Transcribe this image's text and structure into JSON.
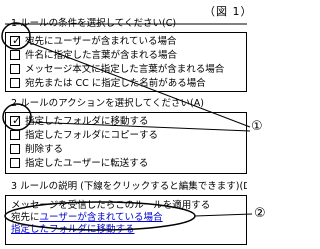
{
  "figure_label": "（図 1）",
  "section1": {
    "header": "1 ルールの条件を選択してください(C)",
    "items": [
      {
        "label": "宛先にユーザーが含まれている場合",
        "checked": true
      },
      {
        "label": "件名に指定した言葉が含まれる場合",
        "checked": false
      },
      {
        "label": "メッセージ本文に指定した言葉が含まれる場合",
        "checked": false
      },
      {
        "label": "宛先または CC に指定した名前がある場合",
        "checked": false
      }
    ]
  },
  "section2": {
    "header": "2 ルールのアクションを選択してください(A)",
    "items": [
      {
        "label": "指定したフォルダに移動する",
        "checked": true
      },
      {
        "label": "指定したフォルダにコピーする",
        "checked": false
      },
      {
        "label": "削除する",
        "checked": false
      },
      {
        "label": "指定したユーザーに転送する",
        "checked": false
      }
    ]
  },
  "section3": {
    "header": "3 ルールの説明 (下線をクリックすると編集できます)(D)",
    "lines": [
      {
        "text": "メッセージを受信したらこのルールを適用する",
        "link": ""
      },
      {
        "text": "宛先に",
        "link": "ユーザーが含まれている場合"
      },
      {
        "text": "",
        "link": "指定したフォルダに移動する"
      }
    ]
  },
  "callouts": {
    "one": "①",
    "two": "②"
  }
}
